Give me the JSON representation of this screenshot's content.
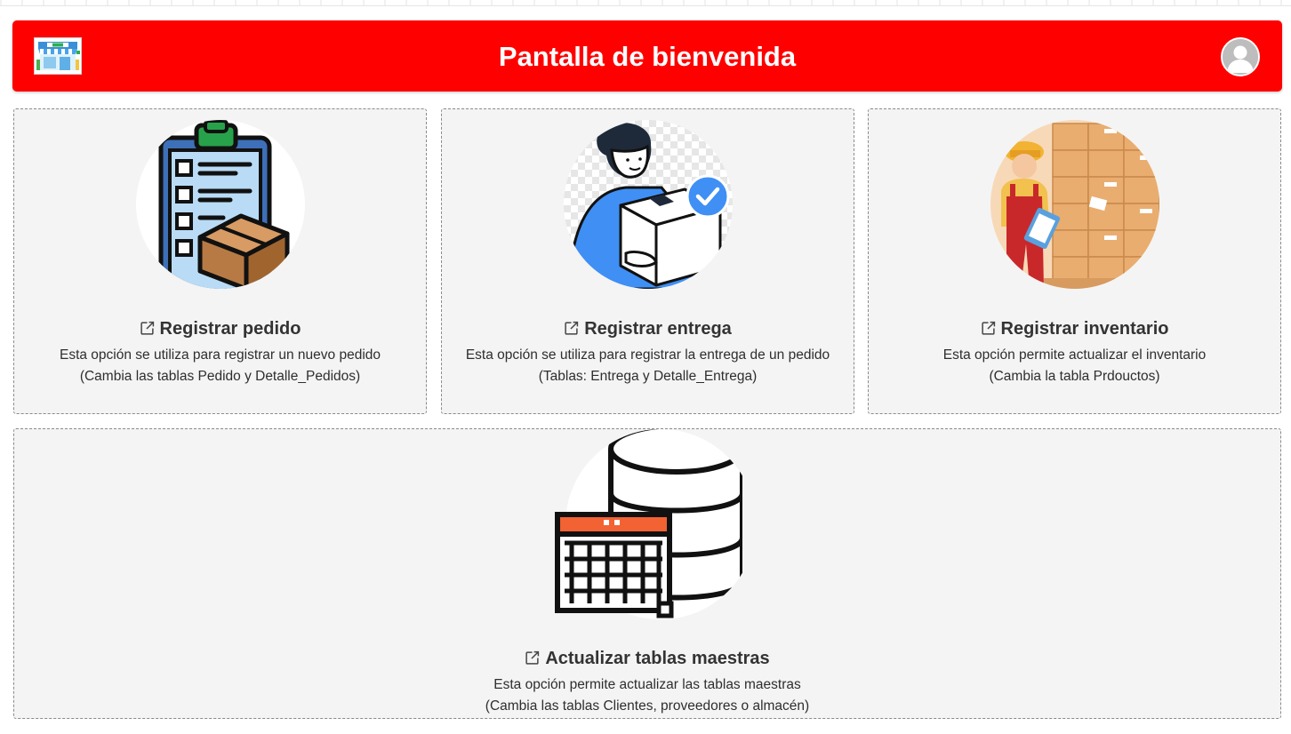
{
  "header": {
    "title": "Pantalla de bienvenida",
    "logo_icon": "pharmacy-store-logo",
    "avatar_icon": "user-avatar-icon",
    "background_color": "#ff0000"
  },
  "cards": [
    {
      "icon": "clipboard-box-icon",
      "link_icon": "external-link-icon",
      "title": "Registrar pedido",
      "desc_line1": "Esta opción se utiliza para registrar un nuevo pedido",
      "desc_line2": "(Cambia las tablas Pedido y Detalle_Pedidos)"
    },
    {
      "icon": "delivery-person-icon",
      "link_icon": "external-link-icon",
      "title": "Registrar entrega",
      "desc_line1": "Esta opción se utiliza para registrar la entrega de un pedido",
      "desc_line2": "(Tablas: Entrega y Detalle_Entrega)"
    },
    {
      "icon": "warehouse-worker-icon",
      "link_icon": "external-link-icon",
      "title": "Registrar inventario",
      "desc_line1": "Esta opción permite actualizar el inventario",
      "desc_line2": "(Cambia la tabla Prdouctos)"
    },
    {
      "icon": "database-calendar-icon",
      "link_icon": "external-link-icon",
      "title": "Actualizar tablas maestras",
      "desc_line1": "Esta opción permite actualizar las tablas maestras",
      "desc_line2": "(Cambia las tablas Clientes, proveedores o almacén)"
    }
  ]
}
